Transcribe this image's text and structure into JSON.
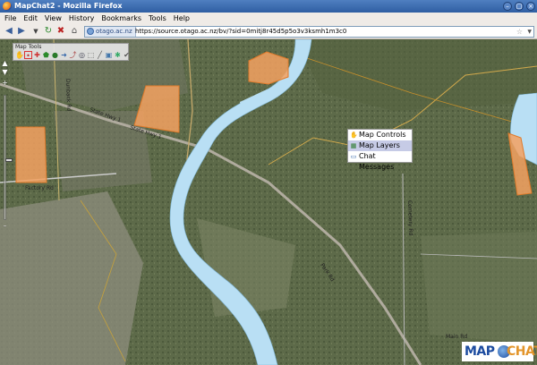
{
  "window": {
    "title": "MapChat2 - Mozilla Firefox"
  },
  "menu": [
    "File",
    "Edit",
    "View",
    "History",
    "Bookmarks",
    "Tools",
    "Help"
  ],
  "nav": {
    "site_identity": "otago.ac.nz",
    "url": "https://source.otago.ac.nz/bv/?sid=0mitj8r45d5p5o3v3ksmh1m3c0"
  },
  "map": {
    "tools_title": "Map Tools",
    "road_labels": [
      "State Hwy 1",
      "State Hwy 1",
      "Factory Rd",
      "Park Rd",
      "Dunback Rd",
      "Cemetery Rd",
      "Main Rd"
    ],
    "colors": {
      "river": "#b9dff4",
      "parcel": "#f3a160",
      "parcel_border": "#e07a2a",
      "terrain": "#5c6848"
    }
  },
  "context_menu": {
    "items": [
      {
        "label": "Map Controls",
        "icon": "hand-icon"
      },
      {
        "label": "Map Layers",
        "icon": "layers-icon",
        "active": true
      },
      {
        "label": "Chat Messages",
        "icon": "chat-icon"
      }
    ]
  },
  "logo": {
    "part1": "MAP",
    "part2": "CHAT"
  }
}
